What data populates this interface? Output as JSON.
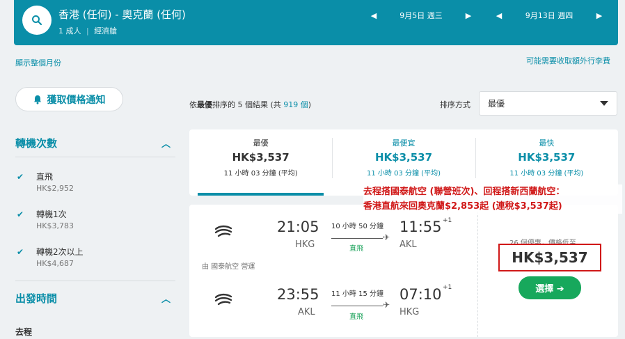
{
  "header": {
    "route": "香港 (任何) - 奧克蘭 (任何)",
    "passengers": "1 成人",
    "cabin": "經濟艙",
    "depart_date": "9月5日 週三",
    "return_date": "9月13日 週四"
  },
  "links": {
    "show_month": "顯示整個月份",
    "baggage_fee": "可能需要收取額外行李費"
  },
  "sidebar": {
    "price_alert": "獲取價格通知",
    "stops": {
      "title": "轉機次數",
      "items": [
        {
          "label": "直飛",
          "price": "HK$2,952",
          "checked": true
        },
        {
          "label": "轉機1次",
          "price": "HK$3,783",
          "checked": true
        },
        {
          "label": "轉機2次以上",
          "price": "HK$4,687",
          "checked": true
        }
      ]
    },
    "times": {
      "title": "出發時間",
      "outbound": "去程"
    }
  },
  "results": {
    "prefix": "依",
    "sort_word": "最優",
    "mid": "排序的 5 個結果 (共 ",
    "total": "919 個",
    "suffix": ")",
    "sort_label": "排序方式",
    "sort_value": "最優"
  },
  "tabs": [
    {
      "label": "最優",
      "price": "HK$3,537",
      "duration": "11 小時 03 分鐘 (平均)"
    },
    {
      "label": "最便宜",
      "price": "HK$3,537",
      "duration": "11 小時 03 分鐘 (平均)"
    },
    {
      "label": "最快",
      "price": "HK$3,537",
      "duration": "11 小時 03 分鐘 (平均)"
    }
  ],
  "flight": {
    "outbound": {
      "dep_time": "21:05",
      "dep_code": "HKG",
      "arr_time": "11:55",
      "arr_code": "AKL",
      "duration": "10 小時 50 分鐘",
      "stops": "直飛",
      "day_offset": "+1"
    },
    "operated_by": "由 國泰航空 營運",
    "inbound": {
      "dep_time": "23:55",
      "dep_code": "AKL",
      "arr_time": "07:10",
      "arr_code": "HKG",
      "duration": "11 小時 15 分鐘",
      "stops": "直飛",
      "day_offset": "+1"
    },
    "deals": "26 個優惠，價格低至",
    "price": "HK$3,537",
    "select": "選擇 ➔"
  },
  "annotation": {
    "line1": "去程搭國泰航空 (聯營班次)、回程搭新西蘭航空：",
    "line2": "香港直航來回奧克蘭$2,853起 (連稅$3,537起)"
  },
  "colors": {
    "brand": "#0a8ea8",
    "green": "#17a85c",
    "red": "#d01818"
  }
}
